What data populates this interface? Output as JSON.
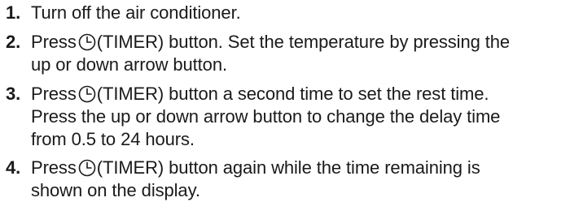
{
  "steps": [
    {
      "number": "1.",
      "line1": "Turn off the air conditioner."
    },
    {
      "number": "2.",
      "before": "Press",
      "button": "(TIMER)",
      "after": " button. Set the temperature by pressing the",
      "line2": "up or down arrow button."
    },
    {
      "number": "3.",
      "before": "Press",
      "button": "(TIMER)",
      "after": " button a second time to set the rest time.",
      "line2": "Press the up or down arrow button to change the delay time",
      "line3": "from 0.5 to 24 hours."
    },
    {
      "number": "4.",
      "before": "Press",
      "button": "(TIMER)",
      "after": " button again while the time remaining is",
      "line2": "shown on the display."
    }
  ],
  "icons": {
    "timer": "timer-clock-icon"
  }
}
